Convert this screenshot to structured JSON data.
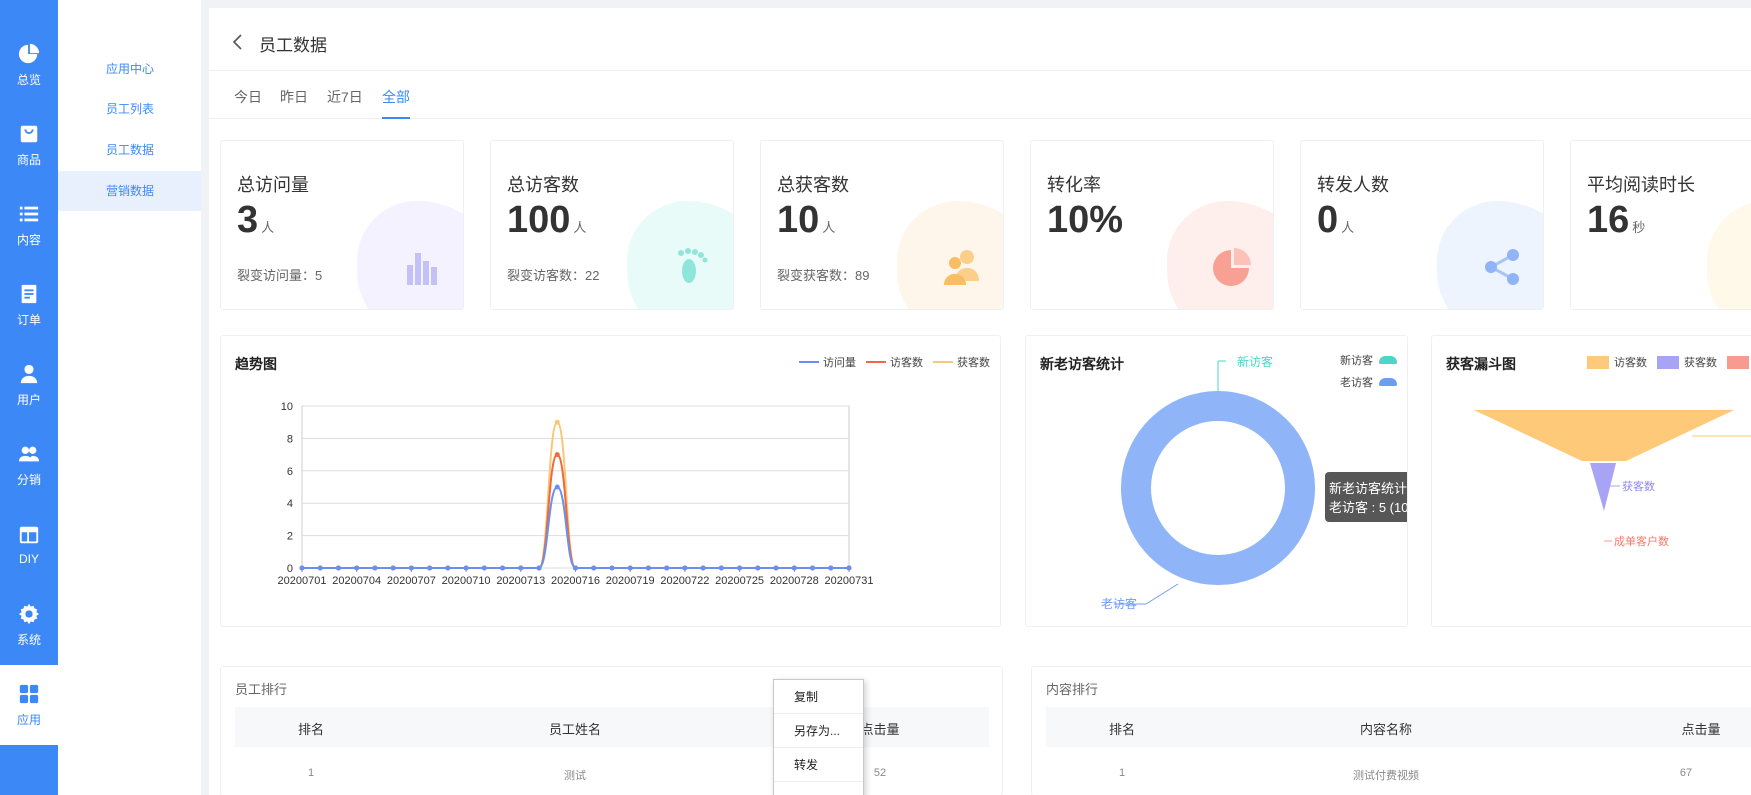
{
  "nav_primary": [
    {
      "label": "总览",
      "icon": "pie-chart-icon"
    },
    {
      "label": "商品",
      "icon": "shopping-bag-icon"
    },
    {
      "label": "内容",
      "icon": "list-icon"
    },
    {
      "label": "订单",
      "icon": "order-icon"
    },
    {
      "label": "用户",
      "icon": "user-icon"
    },
    {
      "label": "分销",
      "icon": "users-icon"
    },
    {
      "label": "DIY",
      "icon": "layout-icon"
    },
    {
      "label": "系统",
      "icon": "gear-icon"
    },
    {
      "label": "应用",
      "icon": "apps-icon",
      "active": true
    }
  ],
  "nav_secondary": [
    {
      "label": "应用中心"
    },
    {
      "label": "员工列表"
    },
    {
      "label": "员工数据"
    },
    {
      "label": "营销数据",
      "active": true
    }
  ],
  "header": {
    "title": "员工数据"
  },
  "tabs": [
    {
      "label": "今日"
    },
    {
      "label": "昨日"
    },
    {
      "label": "近7日"
    },
    {
      "label": "全部",
      "active": true
    }
  ],
  "cards": [
    {
      "title": "总访问量",
      "value": "3",
      "unit": "人",
      "sub": "裂变访问量：5",
      "icon": "bar-chart-icon",
      "color": "#a8a4f5"
    },
    {
      "title": "总访客数",
      "value": "100",
      "unit": "人",
      "sub": "裂变访客数：22",
      "icon": "footprint-icon",
      "color": "#5fd9c8"
    },
    {
      "title": "总获客数",
      "value": "10",
      "unit": "人",
      "sub": "裂变获客数：89",
      "icon": "people-icon",
      "color": "#f8c470"
    },
    {
      "title": "转化率",
      "value": "10%",
      "unit": "",
      "sub": "",
      "icon": "pie-icon",
      "color": "#f89b8e"
    },
    {
      "title": "转发人数",
      "value": "0",
      "unit": "人",
      "sub": "",
      "icon": "share-icon",
      "color": "#7aa9f7"
    },
    {
      "title": "平均阅读时长",
      "value": "16",
      "unit": "秒",
      "sub": "",
      "icon": "clock-icon",
      "color": "#f8d870"
    }
  ],
  "trend": {
    "title": "趋势图",
    "legend": [
      "访问量",
      "访客数",
      "获客数"
    ],
    "colors": [
      "#6b8ff0",
      "#ee6a3d",
      "#f8c878"
    ]
  },
  "visitor": {
    "title": "新老访客统计",
    "legend": [
      "新访客",
      "老访客"
    ],
    "colors": [
      "#4ed4c8",
      "#6d9cf3"
    ],
    "label_new": "新访客",
    "label_old": "老访客",
    "tooltip_title": "新老访客统计",
    "tooltip_line": "老访客 : 5 (10"
  },
  "funnel": {
    "title": "获客漏斗图",
    "legend": [
      "访客数",
      "获客数",
      "成"
    ],
    "colors": [
      "#ffc97a",
      "#a8a4f5",
      "#f89b8e"
    ],
    "label_mid": "获客数",
    "label_bottom": "成单客户数"
  },
  "chart_data": [
    {
      "type": "line",
      "title": "趋势图",
      "x": [
        "20200701",
        "20200702",
        "20200703",
        "20200704",
        "20200705",
        "20200706",
        "20200707",
        "20200708",
        "20200709",
        "20200710",
        "20200711",
        "20200712",
        "20200713",
        "20200714",
        "20200715",
        "20200716",
        "20200717",
        "20200718",
        "20200719",
        "20200720",
        "20200721",
        "20200722",
        "20200723",
        "20200724",
        "20200725",
        "20200726",
        "20200727",
        "20200728",
        "20200729",
        "20200730",
        "20200731"
      ],
      "x_tick_labels": [
        "20200701",
        "20200704",
        "20200707",
        "20200710",
        "20200713",
        "20200716",
        "20200719",
        "20200722",
        "20200725",
        "20200728",
        "20200731"
      ],
      "ylim": [
        0,
        10
      ],
      "y_ticks": [
        "0",
        "2",
        "4",
        "6",
        "8",
        "10"
      ],
      "grid": true,
      "legend_position": "top-right",
      "series": [
        {
          "name": "访问量",
          "values": [
            0,
            0,
            0,
            0,
            0,
            0,
            0,
            0,
            0,
            0,
            0,
            0,
            0,
            0,
            5,
            0,
            0,
            0,
            0,
            0,
            0,
            0,
            0,
            0,
            0,
            0,
            0,
            0,
            0,
            0,
            0
          ]
        },
        {
          "name": "访客数",
          "values": [
            0,
            0,
            0,
            0,
            0,
            0,
            0,
            0,
            0,
            0,
            0,
            0,
            0,
            0,
            7,
            0,
            0,
            0,
            0,
            0,
            0,
            0,
            0,
            0,
            0,
            0,
            0,
            0,
            0,
            0,
            0
          ]
        },
        {
          "name": "获客数",
          "values": [
            0,
            0,
            0,
            0,
            0,
            0,
            0,
            0,
            0,
            0,
            0,
            0,
            0,
            0,
            9,
            0,
            0,
            0,
            0,
            0,
            0,
            0,
            0,
            0,
            0,
            0,
            0,
            0,
            0,
            0,
            0
          ]
        }
      ]
    }
  ],
  "rank_staff": {
    "title": "员工排行",
    "columns": [
      "排名",
      "员工姓名",
      "点击量"
    ],
    "rows": [
      [
        "1",
        "测试",
        "52"
      ]
    ]
  },
  "rank_content": {
    "title": "内容排行",
    "columns": [
      "排名",
      "内容名称",
      "点击量"
    ],
    "rows": [
      [
        "1",
        "测试付费视频",
        "67"
      ]
    ]
  },
  "context_menu": [
    "复制",
    "另存为...",
    "转发"
  ]
}
